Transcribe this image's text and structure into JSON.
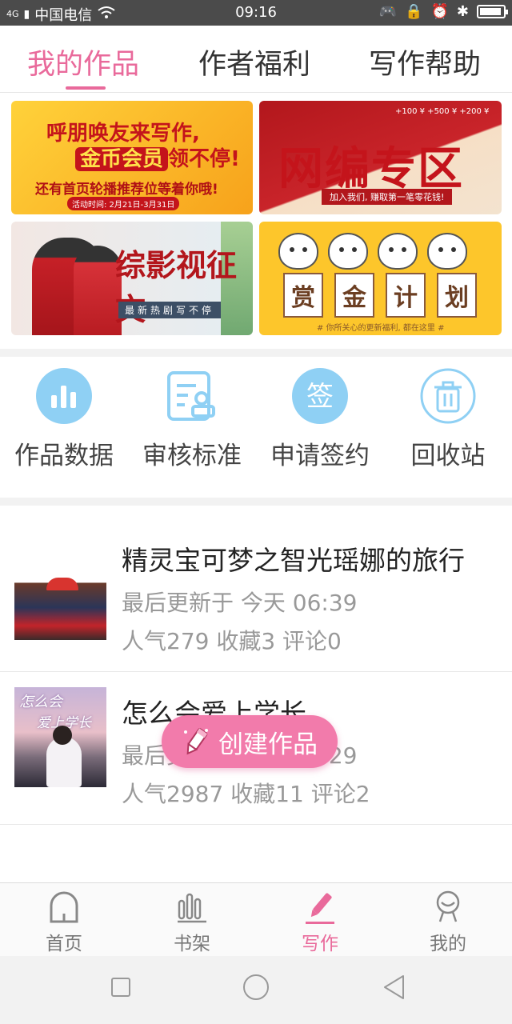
{
  "status_bar": {
    "signal": "4G",
    "carrier": "中国电信",
    "time": "09:16",
    "battery_level": 0.95
  },
  "tabs": [
    {
      "label": "我的作品",
      "active": true
    },
    {
      "label": "作者福利",
      "active": false
    },
    {
      "label": "写作帮助",
      "active": false
    }
  ],
  "banners": {
    "b1": {
      "line1": "呼朋唤友来写作,",
      "line2_badge": "金币会员",
      "line2_rest": "领不停!",
      "line3": "还有首页轮播推荐位等着你哦!",
      "line4": "活动时间: 2月21日-3月31日"
    },
    "b2": {
      "coins": "+100 ¥   +500 ¥   +200 ¥",
      "title": "网编专区",
      "sub": "加入我们, 赚取第一笔零花钱!"
    },
    "b3": {
      "title": "综影视征文",
      "sub": "最新热剧写不停"
    },
    "b4": {
      "chars": [
        "赏",
        "金",
        "计",
        "划"
      ],
      "sub": "# 你所关心的更新福利, 都在这里 #"
    }
  },
  "actions": [
    {
      "label": "作品数据",
      "icon": "chart-icon"
    },
    {
      "label": "审核标准",
      "icon": "review-doc-icon"
    },
    {
      "label": "申请签约",
      "icon": "sign-icon",
      "glyph": "签"
    },
    {
      "label": "回收站",
      "icon": "trash-icon"
    }
  ],
  "works": [
    {
      "title": "精灵宝可梦之智光瑶娜的旅行",
      "updated": "最后更新于 今天 06:39",
      "stats": "人气279 收藏3 评论0"
    },
    {
      "title": "怎么会爱上学长",
      "updated": "最后更新于 今天 06:29",
      "stats": "人气2987 收藏11 评论2",
      "cover_text1": "怎么会",
      "cover_text2": "爱上学长"
    }
  ],
  "fab": {
    "label": "创建作品",
    "color": "#f27bab"
  },
  "bottom_nav": [
    {
      "label": "首页",
      "active": false,
      "icon": "home-icon"
    },
    {
      "label": "书架",
      "active": false,
      "icon": "bookshelf-icon"
    },
    {
      "label": "写作",
      "active": true,
      "icon": "pen-icon"
    },
    {
      "label": "我的",
      "active": false,
      "icon": "profile-icon"
    }
  ],
  "colors": {
    "accent": "#e96a9b",
    "status_bar": "#4b4b4b",
    "action_icon": "#8fd0f4"
  }
}
